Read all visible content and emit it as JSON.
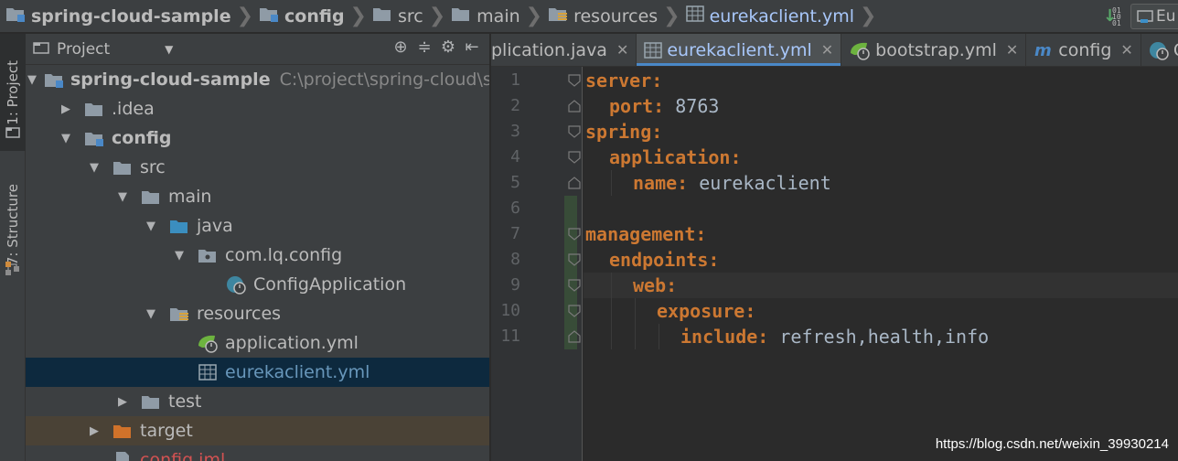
{
  "navbar": {
    "crumbs": [
      {
        "label": "spring-cloud-sample",
        "icon": "module-folder-icon",
        "bold": true
      },
      {
        "label": "config",
        "icon": "module-folder-icon",
        "bold": true
      },
      {
        "label": "src",
        "icon": "folder-icon"
      },
      {
        "label": "main",
        "icon": "folder-icon"
      },
      {
        "label": "resources",
        "icon": "resources-folder-icon"
      },
      {
        "label": "eurekaclient.yml",
        "icon": "yaml-file-icon",
        "active": true
      }
    ],
    "run_config_label": "Eu"
  },
  "left_strip": {
    "project_tab": "1: Project",
    "structure_tab": "7: Structure"
  },
  "project_panel": {
    "title": "Project",
    "tree": [
      {
        "label": "spring-cloud-sample",
        "path": "C:\\project\\spring-cloud\\sprin",
        "depth": 0,
        "arrow": "down",
        "icon": "module-folder-icon",
        "bold": true
      },
      {
        "label": ".idea",
        "depth": 1,
        "arrow": "right",
        "icon": "folder-icon"
      },
      {
        "label": "config",
        "depth": 1,
        "arrow": "down",
        "icon": "module-folder-icon",
        "bold": true
      },
      {
        "label": "src",
        "depth": 2,
        "arrow": "down",
        "icon": "folder-icon"
      },
      {
        "label": "main",
        "depth": 3,
        "arrow": "down",
        "icon": "folder-icon"
      },
      {
        "label": "java",
        "depth": 4,
        "arrow": "down",
        "icon": "source-folder-icon"
      },
      {
        "label": "com.lq.config",
        "depth": 5,
        "arrow": "down",
        "icon": "package-icon"
      },
      {
        "label": "ConfigApplication",
        "depth": 6,
        "arrow": "none",
        "icon": "spring-boot-class-icon"
      },
      {
        "label": "resources",
        "depth": 4,
        "arrow": "down",
        "icon": "resources-folder-icon"
      },
      {
        "label": "application.yml",
        "depth": 5,
        "arrow": "none",
        "icon": "spring-yaml-icon"
      },
      {
        "label": "eurekaclient.yml",
        "depth": 5,
        "arrow": "none",
        "icon": "yaml-file-icon",
        "selected": true,
        "blue": true
      },
      {
        "label": "test",
        "depth": 3,
        "arrow": "right",
        "icon": "folder-icon"
      },
      {
        "label": "target",
        "depth": 2,
        "arrow": "right",
        "icon": "excluded-folder-icon",
        "excluded": true
      },
      {
        "label": "config.iml",
        "depth": 2,
        "arrow": "none",
        "icon": "iml-file-icon",
        "red": true
      }
    ]
  },
  "editor": {
    "tabs": [
      {
        "label": "plication.java",
        "icon": "",
        "close": true
      },
      {
        "label": "eurekaclient.yml",
        "icon": "yaml-file-icon",
        "active": true,
        "close": true
      },
      {
        "label": "bootstrap.yml",
        "icon": "spring-yaml-icon",
        "close": true
      },
      {
        "label": "config",
        "icon": "maven-m-icon",
        "close": true
      },
      {
        "label": "Confi",
        "icon": "spring-boot-class-icon",
        "close": false
      }
    ],
    "lines": [
      {
        "num": "1",
        "indent": 0,
        "key": "server:",
        "value": ""
      },
      {
        "num": "2",
        "indent": 1,
        "key": "port:",
        "value": " 8763"
      },
      {
        "num": "3",
        "indent": 0,
        "key": "spring:",
        "value": ""
      },
      {
        "num": "4",
        "indent": 1,
        "key": "application:",
        "value": ""
      },
      {
        "num": "5",
        "indent": 2,
        "key": "name:",
        "value": " eurekaclient"
      },
      {
        "num": "6",
        "indent": 0,
        "key": "",
        "value": ""
      },
      {
        "num": "7",
        "indent": 0,
        "key": "management:",
        "value": ""
      },
      {
        "num": "8",
        "indent": 1,
        "key": "endpoints:",
        "value": ""
      },
      {
        "num": "9",
        "indent": 2,
        "key": "web:",
        "value": "",
        "current": true
      },
      {
        "num": "10",
        "indent": 3,
        "key": "exposure:",
        "value": ""
      },
      {
        "num": "11",
        "indent": 4,
        "key": "include:",
        "value": " refresh,health,info"
      }
    ]
  },
  "watermark": "https://blog.csdn.net/weixin_39930214",
  "colors": {
    "yaml_key": "#cc7832",
    "yaml_value": "#a9b7c6",
    "selection": "#0d293e",
    "active_tab_text": "#a8c7fa",
    "background": "#2b2b2b"
  }
}
